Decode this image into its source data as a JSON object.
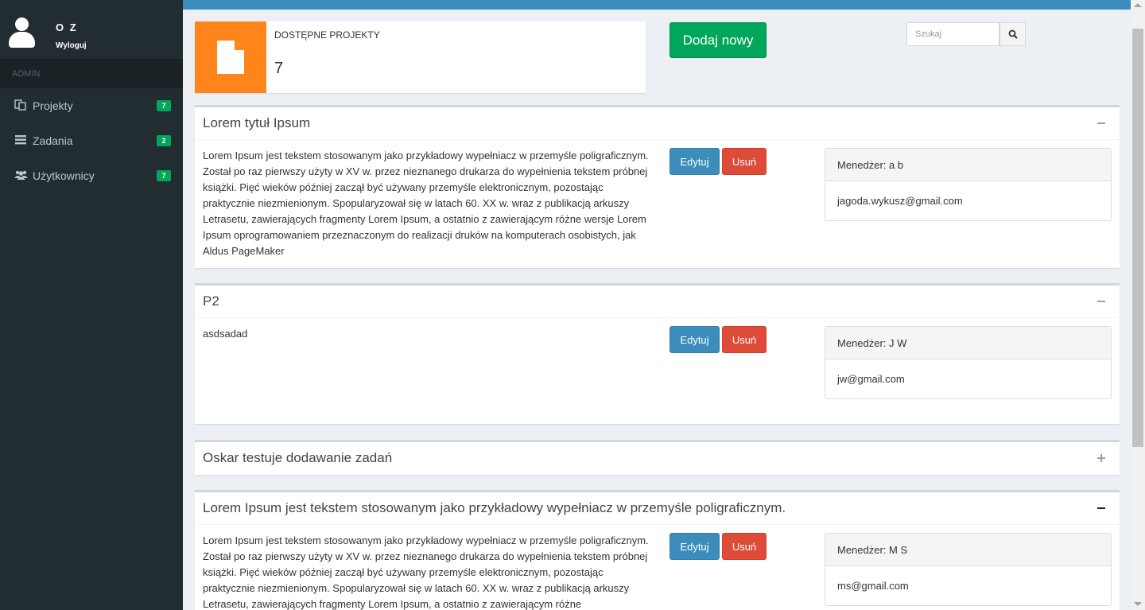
{
  "sidebar": {
    "user_name": "O Z",
    "logout_label": "Wyloguj",
    "section_header": "ADMIN",
    "items": [
      {
        "label": "Projekty",
        "badge": "7",
        "icon": "projects-icon"
      },
      {
        "label": "Zadania",
        "badge": "2",
        "icon": "tasks-icon"
      },
      {
        "label": "Użytkownicy",
        "badge": "7",
        "icon": "users-icon"
      }
    ]
  },
  "info_box": {
    "label": "DOSTĘPNE PROJEKTY",
    "count": "7",
    "icon": "document-icon",
    "color": "#ff851b"
  },
  "toolbar": {
    "add_label": "Dodaj nowy",
    "search_placeholder": "Szukaj"
  },
  "projects": [
    {
      "title": "Lorem tytuł Ipsum",
      "description": "Lorem Ipsum jest tekstem stosowanym jako przykładowy wypełniacz w przemyśle poligraficznym. Został po raz pierwszy użyty w XV w. przez nieznanego drukarza do wypełnienia tekstem próbnej książki. Pięć wieków później zaczął być używany przemyśle elektronicznym, pozostając praktycznie niezmienionym. Spopularyzował się w latach 60. XX w. wraz z publikacją arkuszy Letrasetu, zawierających fragmenty Lorem Ipsum, a ostatnio z zawierającym różne wersje Lorem Ipsum oprogramowaniem przeznaczonym do realizacji druków na komputerach osobistych, jak Aldus PageMaker",
      "edit_label": "Edytuj",
      "delete_label": "Usuń",
      "manager": "Menedżer: a b",
      "email": "jagoda.wykusz@gmail.com",
      "collapsed": false
    },
    {
      "title": "P2",
      "description": "asdsadad",
      "edit_label": "Edytuj",
      "delete_label": "Usuń",
      "manager": "Menedżer: J W",
      "email": "jw@gmail.com",
      "collapsed": false
    },
    {
      "title": "Oskar testuje dodawanie zadań",
      "collapsed": true
    },
    {
      "title": "Lorem Ipsum jest tekstem stosowanym jako przykładowy wypełniacz w przemyśle poligraficznym.",
      "description": "Lorem Ipsum jest tekstem stosowanym jako przykładowy wypełniacz w przemyśle poligraficznym. Został po raz pierwszy użyty w XV w. przez nieznanego drukarza do wypełnienia tekstem próbnej książki. Pięć wieków później zaczął być używany przemyśle elektronicznym, pozostając praktycznie niezmienionym. Spopularyzował się w latach 60. XX w. wraz z publikacją arkuszy Letrasetu, zawierających fragmenty Lorem Ipsum, a ostatnio z zawierającym różne",
      "edit_label": "Edytuj",
      "delete_label": "Usuń",
      "manager": "Menedżer: M S",
      "email": "ms@gmail.com",
      "collapsed": false
    }
  ],
  "colors": {
    "sidebar_bg": "#222d32",
    "topbar": "#3c8dbc",
    "success": "#00a65a",
    "primary": "#3c8dbc",
    "danger": "#dd4b39"
  }
}
